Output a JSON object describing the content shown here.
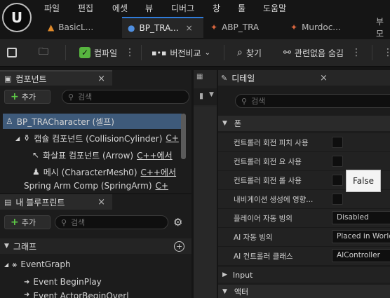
{
  "menu": [
    "파일",
    "편집",
    "에셋",
    "뷰",
    "디버그",
    "창",
    "툴",
    "도움말"
  ],
  "logo_text": "U",
  "tabs": [
    {
      "label": "BasicL...",
      "close": ""
    },
    {
      "label": "BP_TRA...",
      "close": "×"
    },
    {
      "label": "ABP_TRA",
      "close": ""
    },
    {
      "label": "Murdoc...",
      "close": ""
    },
    {
      "label": "부모",
      "close": ""
    }
  ],
  "toolbar": {
    "compile": "컴파일",
    "version": "버전비교",
    "find": "찾기",
    "hide_unrelated": "관련없음 숨김"
  },
  "components": {
    "title": "컴포넌트",
    "close": "×",
    "add": "추가",
    "search_placeholder": "검색",
    "items": [
      {
        "label": "BP_TRACharacter (셀프)",
        "suffix": ""
      },
      {
        "label": "캡슐 컴포넌트 (CollisionCylinder)",
        "suffix": "C+"
      },
      {
        "label": "화살표 컴포넌트 (Arrow)",
        "suffix": "C++에서"
      },
      {
        "label": "메시 (CharacterMesh0)",
        "suffix": "C++에서 "
      },
      {
        "label": "Spring Arm Comp (SpringArm)",
        "suffix": "C+"
      }
    ]
  },
  "blueprint": {
    "title": "내 블루프린트",
    "close": "×",
    "add": "추가",
    "search_placeholder": "검색",
    "section_graph": "그래프",
    "items": [
      "EventGraph",
      "Event BeginPlay",
      "Event ActorBeginOverl"
    ]
  },
  "details": {
    "title": "디테일",
    "close": "×",
    "search_placeholder": "검색",
    "section_pawn": "폰",
    "rows": [
      {
        "label": "컨트롤러 회전 피치 사용",
        "type": "checkbox",
        "value": ""
      },
      {
        "label": "컨트롤러 회전 요 사용",
        "type": "checkbox",
        "value": ""
      },
      {
        "label": "컨트롤러 회전 롤 사용",
        "type": "checkbox",
        "value": ""
      },
      {
        "label": "내비게이션 생성에 영향...",
        "type": "checkbox",
        "value": ""
      },
      {
        "label": "플레이어 자동 빙의",
        "type": "combo",
        "value": "Disabled"
      },
      {
        "label": "AI 자동 빙의",
        "type": "combo",
        "value": "Placed in World"
      },
      {
        "label": "AI 컨트롤러 클래스",
        "type": "combo",
        "value": "AIController"
      }
    ],
    "tooltip": "False",
    "section_input": "Input",
    "section_actor": "액터"
  }
}
